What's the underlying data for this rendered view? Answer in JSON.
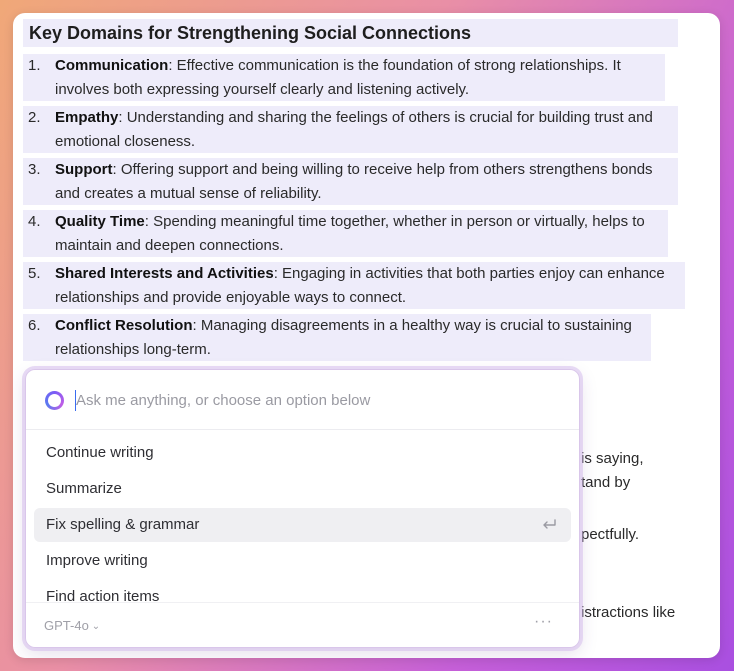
{
  "document": {
    "title": "Key Domains for Strengthening Social Connections",
    "items": [
      {
        "num": "1.",
        "term": "Communication",
        "line1": ": Effective communication is the foundation of strong relationships. It",
        "line2": "involves both expressing yourself clearly and listening actively."
      },
      {
        "num": "2.",
        "term": "Empathy",
        "line1": ": Understanding and sharing the feelings of others is crucial for building trust and",
        "line2": "emotional closeness."
      },
      {
        "num": "3.",
        "term": "Support",
        "line1": ": Offering support and being willing to receive help from others strengthens bonds",
        "line2": "and creates a mutual sense of reliability."
      },
      {
        "num": "4.",
        "term": "Quality Time",
        "line1": ": Spending meaningful time together, whether in person or virtually, helps to",
        "line2": "maintain and deepen connections."
      },
      {
        "num": "5.",
        "term": "Shared Interests and Activities",
        "line1": ": Engaging in activities that both parties enjoy can enhance",
        "line2": "relationships and provide enjoyable ways to connect."
      },
      {
        "num": "6.",
        "term": "Conflict Resolution",
        "line1": ": Managing disagreements in a healthy way is crucial to sustaining",
        "line2": "relationships long-term."
      }
    ],
    "hidden_fragments": [
      "is saying,",
      "tand by",
      "pectfully.",
      "istractions like"
    ]
  },
  "ai_panel": {
    "placeholder": "Ask me anything, or choose an option below",
    "menu": [
      {
        "label": "Continue writing"
      },
      {
        "label": "Summarize"
      },
      {
        "label": "Fix spelling & grammar"
      },
      {
        "label": "Improve writing"
      },
      {
        "label": "Find action items"
      }
    ],
    "selected_index": 2,
    "model": "GPT-4o",
    "more": "···"
  },
  "colors": {
    "highlight": "#e8e6f8",
    "accent": "#7b5cf5",
    "caret": "#3a6cf0"
  }
}
